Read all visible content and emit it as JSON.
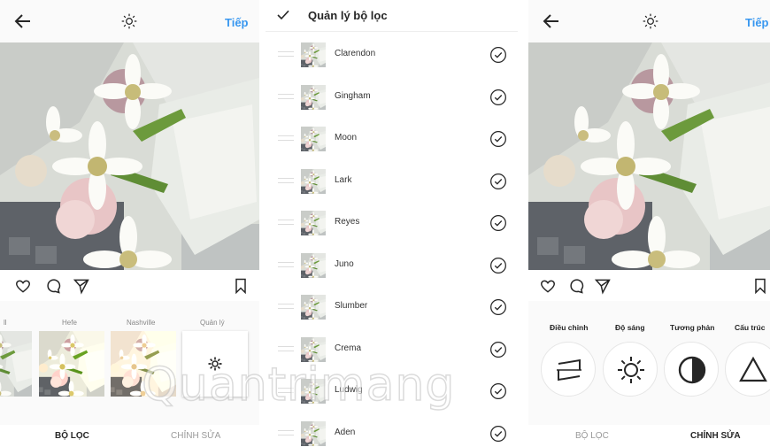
{
  "left": {
    "next_label": "Tiếp",
    "filters": [
      {
        "label": "ll"
      },
      {
        "label": "Hefe"
      },
      {
        "label": "Nashville"
      },
      {
        "label": "Quản lý"
      }
    ],
    "tabs": {
      "filter": "BỘ LỌC",
      "edit": "CHỈNH SỬA"
    }
  },
  "manager": {
    "title": "Quản lý bộ lọc",
    "items": [
      "Clarendon",
      "Gingham",
      "Moon",
      "Lark",
      "Reyes",
      "Juno",
      "Slumber",
      "Crema",
      "Ludwig",
      "Aden"
    ]
  },
  "right": {
    "next_label": "Tiếp",
    "tools": [
      {
        "label": "Điều chỉnh",
        "icon": "adjust-icon"
      },
      {
        "label": "Độ sáng",
        "icon": "brightness-icon"
      },
      {
        "label": "Tương phản",
        "icon": "contrast-icon"
      },
      {
        "label": "Cấu trúc",
        "icon": "structure-icon"
      }
    ],
    "tabs": {
      "filter": "BỘ LỌC",
      "edit": "CHỈNH SỬA"
    }
  },
  "watermark": "Quantrimang",
  "colors": {
    "accent": "#3897f0",
    "text": "#262626",
    "muted": "#999999",
    "background": "#fafafa"
  }
}
